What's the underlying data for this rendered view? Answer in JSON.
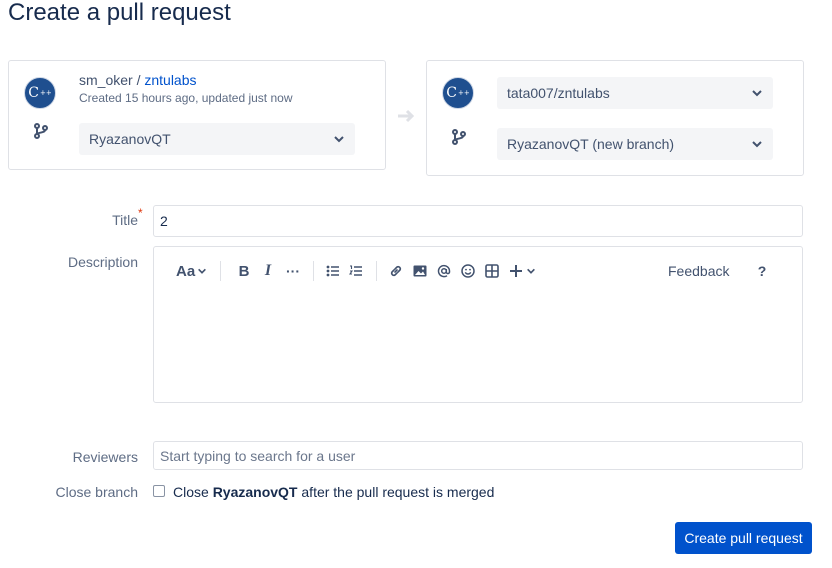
{
  "page": {
    "title": "Create a pull request"
  },
  "source": {
    "owner": "sm_oker",
    "separator": " / ",
    "repo": "zntulabs",
    "meta": "Created 15 hours ago, updated just now",
    "avatar_text": "C",
    "avatar_sup": "++",
    "branch": "RyazanovQT"
  },
  "target": {
    "avatar_text": "C",
    "avatar_sup": "++",
    "repo": "tata007/zntulabs",
    "branch": "RyazanovQT (new branch)"
  },
  "form": {
    "title_label": "Title",
    "title_required_mark": "*",
    "title_value": "2",
    "description_label": "Description",
    "reviewers_label": "Reviewers",
    "reviewers_placeholder": "Start typing to search for a user",
    "close_branch_label": "Close branch",
    "close_branch_prefix": "Close ",
    "close_branch_name": "RyazanovQT",
    "close_branch_suffix": " after the pull request is merged",
    "close_branch_checked": false
  },
  "toolbar": {
    "text_style": "Aa",
    "bold": "B",
    "italic": "I",
    "more": "···",
    "feedback": "Feedback",
    "help": "?"
  },
  "actions": {
    "create_label": "Create pull request"
  },
  "colors": {
    "primary": "#0052cc",
    "border": "#dfe1e6",
    "select_bg": "#f4f5f7",
    "required": "#de350b"
  }
}
